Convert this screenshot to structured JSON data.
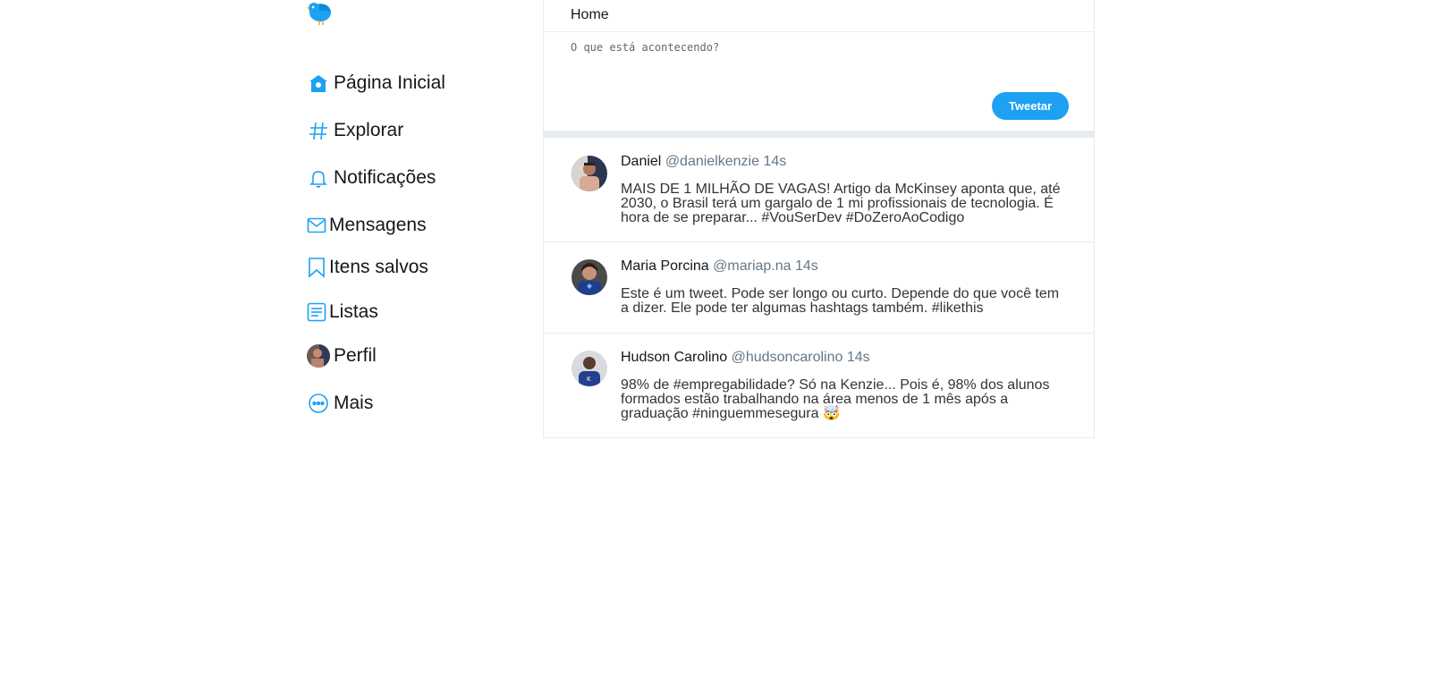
{
  "nav": {
    "items": [
      {
        "label": "Página Inicial",
        "icon": "home-icon"
      },
      {
        "label": "Explorar",
        "icon": "hashtag-icon"
      },
      {
        "label": "Notificações",
        "icon": "bell-icon"
      },
      {
        "label": "Mensagens",
        "icon": "envelope-icon"
      },
      {
        "label": "Itens salvos",
        "icon": "bookmark-icon"
      },
      {
        "label": "Listas",
        "icon": "list-icon"
      },
      {
        "label": "Perfil",
        "icon": "avatar"
      },
      {
        "label": "Mais",
        "icon": "more-icon"
      }
    ]
  },
  "header": {
    "title": "Home"
  },
  "composer": {
    "placeholder": "O que está acontecendo?",
    "button_label": "Tweetar"
  },
  "tweets": [
    {
      "name": "Daniel",
      "handle": "@danielkenzie",
      "time": "14s",
      "text": "MAIS DE 1 MILHÃO DE VAGAS! Artigo da McKinsey aponta que, até 2030, o Brasil terá um gargalo de 1 mi profissionais de tecnologia. É hora de se preparar... #VouSerDev #DoZeroAoCodigo"
    },
    {
      "name": "Maria Porcina",
      "handle": "@mariap.na",
      "time": "14s",
      "text": "Este é um tweet. Pode ser longo ou curto. Depende do que você tem a dizer. Ele pode ter algumas hashtags também. #likethis"
    },
    {
      "name": "Hudson Carolino",
      "handle": "@hudsoncarolino",
      "time": "14s",
      "text": "98% de #empregabilidade? Só na Kenzie... Pois é, 98% dos alunos formados estão trabalhando na área menos de 1 mês após a graduação #ninguemmesegura 🤯"
    }
  ],
  "colors": {
    "accent": "#1da1f2",
    "border": "#e6ecf0",
    "muted": "#657786"
  }
}
